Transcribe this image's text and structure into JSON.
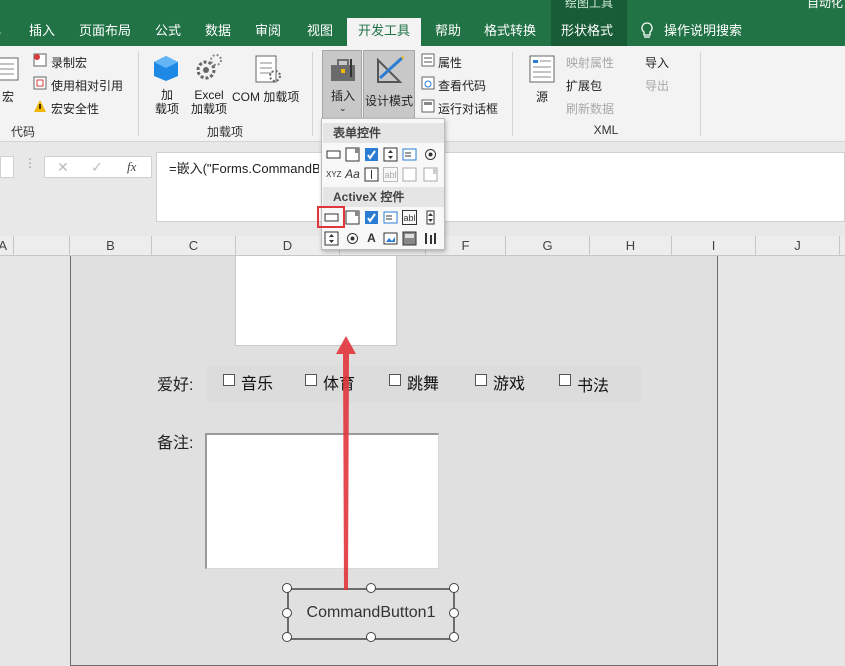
{
  "ribbon_tabs": [
    "插入",
    "页面布局",
    "公式",
    "数据",
    "审阅",
    "视图",
    "开发工具",
    "帮助",
    "格式转换",
    "形状格式",
    "操作说明搜索"
  ],
  "context_tab_label": "绘图工具",
  "account_label": "自动化",
  "code_group": {
    "record_macro": "录制宏",
    "relative_ref": "使用相对引用",
    "macro_security": "宏安全性",
    "macro_label": "宏",
    "group_label": "代码"
  },
  "addins_group": {
    "addins": "加\n载项",
    "excel_addins": "Excel\n加载项",
    "com_addins": "COM 加载项",
    "group_label": "加载项"
  },
  "controls_group": {
    "insert": "插入",
    "design_mode": "设计模式",
    "properties": "属性",
    "view_code": "查看代码",
    "run_dialog": "运行对话框"
  },
  "xml_group": {
    "source": "源",
    "map_props": "映射属性",
    "expansion": "扩展包",
    "refresh": "刷新数据",
    "import": "导入",
    "export": "导出",
    "group_label": "XML"
  },
  "dropdown": {
    "form_controls": "表单控件",
    "activex_controls": "ActiveX 控件"
  },
  "formula": {
    "cancel": "✕",
    "enter": "✓",
    "fx": "fx",
    "content": "=嵌入(\"Forms.CommandButton.1\",\"\")"
  },
  "columns": [
    "A",
    "B",
    "C",
    "D",
    "E",
    "F",
    "G",
    "H",
    "I",
    "J"
  ],
  "form": {
    "hobby_label": "爱好:",
    "hobbies": [
      "音乐",
      "体育",
      "跳舞",
      "游戏",
      "书法"
    ],
    "note_label": "备注:",
    "button_caption": "CommandButton1"
  },
  "colors": {
    "excel_green": "#217346",
    "arrow_red": "#e0353b",
    "highlight": "#e0353b"
  }
}
